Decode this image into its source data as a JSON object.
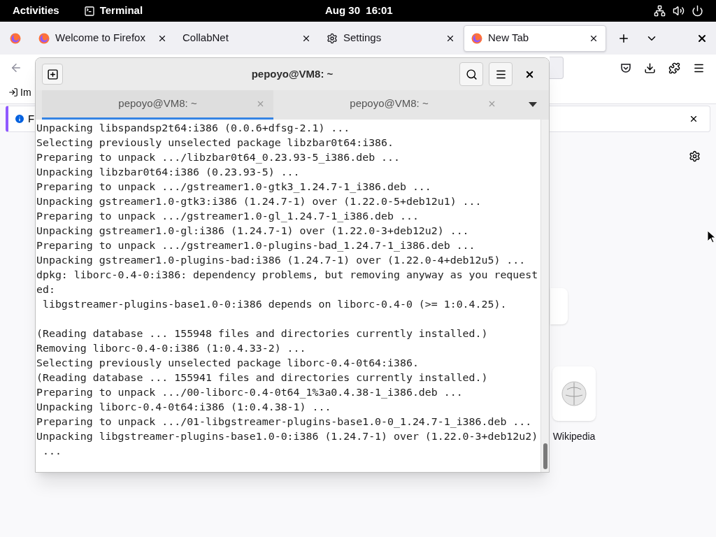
{
  "top_bar": {
    "activities": "Activities",
    "app": "Terminal",
    "clock": "Aug 30  16:01"
  },
  "browser": {
    "tabs": [
      {
        "label": "Welcome to Firefox",
        "kind": "firefox",
        "selected": false
      },
      {
        "label": "CollabNet",
        "kind": "plain",
        "selected": false
      },
      {
        "label": "Settings",
        "kind": "gear",
        "selected": false
      },
      {
        "label": "New Tab",
        "kind": "firefox",
        "selected": true
      }
    ],
    "bookmarks": [
      {
        "label": "Im"
      }
    ],
    "notification": {
      "text": "F"
    },
    "shortcuts": [
      {
        "label": "Wikipedia"
      }
    ]
  },
  "terminal": {
    "title": "pepoyo@VM8: ~",
    "tabs": [
      {
        "label": "pepoyo@VM8: ~",
        "selected": true
      },
      {
        "label": "pepoyo@VM8: ~",
        "selected": false
      }
    ],
    "output": [
      [
        "Unpacking libspandsp2t64:i386 (0.0.6+dfsg-2.1) ...",
        "Selecting previously unselected package libzbar0t64:i386.",
        "Preparing to unpack .../libzbar0t64_0.23.93-5_i386.deb ...",
        "Unpacking libzbar0t64:i386 (0.23.93-5) ...",
        "Preparing to unpack .../gstreamer1.0-gtk3_1.24.7-1_i386.deb ...",
        "Unpacking gstreamer1.0-gtk3:i386 (1.24.7-1) over (1.22.0-5+deb12u1) ...",
        "Preparing to unpack .../gstreamer1.0-gl_1.24.7-1_i386.deb ...",
        "Unpacking gstreamer1.0-gl:i386 (1.24.7-1) over (1.22.0-3+deb12u2) ...",
        "Preparing to unpack .../gstreamer1.0-plugins-bad_1.24.7-1_i386.deb ...",
        "Unpacking gstreamer1.0-plugins-bad:i386 (1.24.7-1) over (1.22.0-4+deb12u5) ...",
        "dpkg: liborc-0.4-0:i386: dependency problems, but removing anyway as you request",
        "ed:",
        " libgstreamer-plugins-base1.0-0:i386 depends on liborc-0.4-0 (>= 1:0.4.25)."
      ],
      [
        "(Reading database ... 155948 files and directories currently installed.)",
        "Removing liborc-0.4-0:i386 (1:0.4.33-2) ...",
        "Selecting previously unselected package liborc-0.4-0t64:i386.",
        "(Reading database ... 155941 files and directories currently installed.)",
        "Preparing to unpack .../00-liborc-0.4-0t64_1%3a0.4.38-1_i386.deb ...",
        "Unpacking liborc-0.4-0t64:i386 (1:0.4.38-1) ...",
        "Preparing to unpack .../01-libgstreamer-plugins-base1.0-0_1.24.7-1_i386.deb ...",
        "Unpacking libgstreamer-plugins-base1.0-0:i386 (1.24.7-1) over (1.22.0-3+deb12u2)",
        " ..."
      ]
    ]
  }
}
